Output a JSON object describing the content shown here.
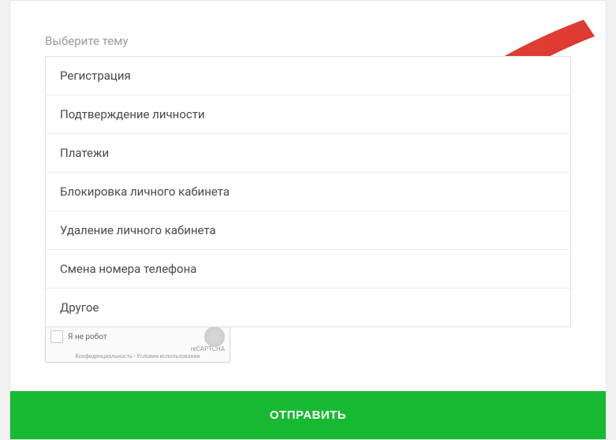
{
  "select": {
    "placeholder": "Выберите тему",
    "options": [
      "Регистрация",
      "Подтверждение личности",
      "Платежи",
      "Блокировка личного кабинета",
      "Удаление личного кабинета",
      "Смена номера телефона",
      "Другое"
    ]
  },
  "recaptcha": {
    "label": "Я не робот",
    "brand": "reCAPTCHA",
    "legal": "Конфиденциальность - Условия использования"
  },
  "submit_label": "ОТПРАВИТЬ",
  "colors": {
    "accent": "#18b932",
    "arrow": "#e03b32"
  }
}
